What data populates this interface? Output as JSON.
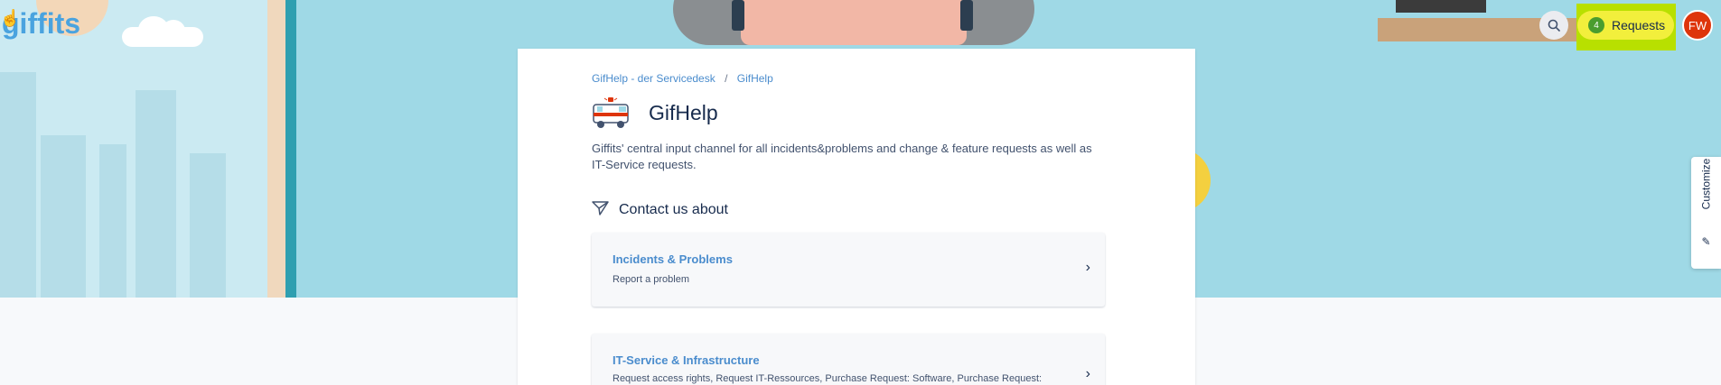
{
  "header": {
    "logo_text": "giffits",
    "requests_label": "Requests",
    "requests_count": "4",
    "avatar_initials": "FW",
    "search_icon": "search-icon",
    "customize_label": "Customize"
  },
  "breadcrumb": {
    "items": [
      "GifHelp - der Servicedesk",
      "GifHelp"
    ],
    "separator": "/"
  },
  "desk": {
    "title": "GifHelp",
    "description": "Giffits' central input channel for all incidents&problems and change & feature requests as well as IT-Service requests."
  },
  "contact": {
    "title": "Contact us about"
  },
  "request_types": [
    {
      "title": "Incidents & Problems",
      "description": "Report a problem"
    },
    {
      "title": "IT-Service & Infrastructure",
      "description": "Request access rights, Request IT-Ressources, Purchase Request: Software, Purchase Request:"
    }
  ],
  "colors": {
    "link": "#4a8ccd",
    "requests_highlight": "#b8e000",
    "requests_button": "#f2ef3c",
    "avatar": "#de350b"
  }
}
